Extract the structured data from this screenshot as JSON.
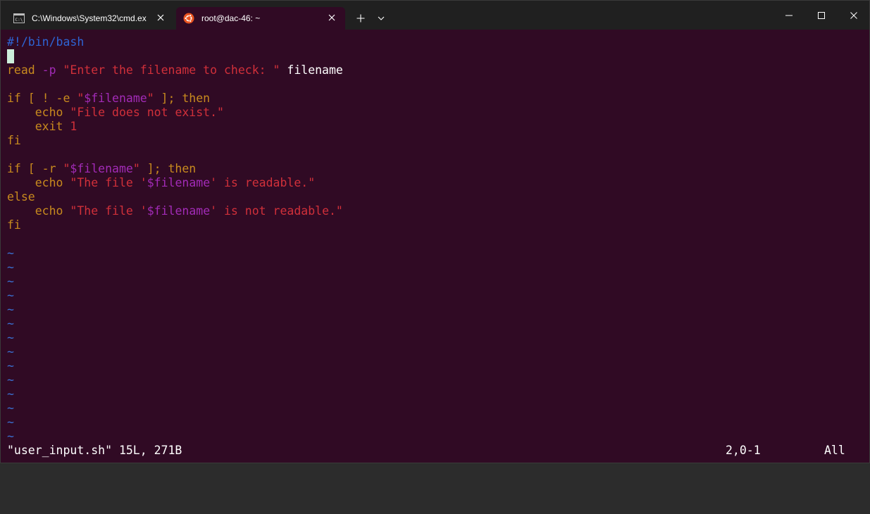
{
  "window": {
    "tabs": [
      {
        "title": "C:\\Windows\\System32\\cmd.ex",
        "icon": "cmd-icon",
        "active": false
      },
      {
        "title": "root@dac-46: ~",
        "icon": "ubuntu-icon",
        "active": true
      }
    ],
    "new_tab_icon": "plus-icon",
    "dropdown_icon": "chevron-down-icon",
    "controls": [
      "minimize-icon",
      "maximize-icon",
      "close-icon"
    ]
  },
  "editor": {
    "lines": {
      "l1": {
        "shebang": "#!/bin/bash"
      },
      "l3": {
        "kw": "read",
        "opt": " -p",
        "str": " \"Enter the filename to check: \"",
        "plain": " filename"
      },
      "l5": {
        "kw1": "if [ ! -e ",
        "q1": "\"",
        "var": "$filename",
        "q2": "\"",
        "kw2": " ]; then"
      },
      "l6": {
        "indent": "    ",
        "kw": "echo",
        "str": " \"File does not exist.\""
      },
      "l7": {
        "indent": "    ",
        "kw": "exit",
        "str": " 1"
      },
      "l8": {
        "kw": "fi"
      },
      "l10": {
        "kw1": "if [ -r ",
        "q1": "\"",
        "var": "$filename",
        "q2": "\"",
        "kw2": " ]; then"
      },
      "l11": {
        "indent": "    ",
        "kw": "echo",
        "str1": " \"The file '",
        "var": "$filename",
        "str2": "' is readable.\""
      },
      "l12": {
        "kw": "else"
      },
      "l13": {
        "indent": "    ",
        "kw": "echo",
        "str1": " \"The file '",
        "var": "$filename",
        "str2": "' is not readable.\""
      },
      "l14": {
        "kw": "fi"
      }
    },
    "tilde": "~",
    "tilde_count": 14
  },
  "status": {
    "file": "\"user_input.sh\" 15L, 271B",
    "position": "2,0-1",
    "scroll": "All"
  },
  "colors": {
    "background": "#300a24",
    "keyword": "#c88a1e",
    "string": "#d1303a",
    "variable": "#a22bb7",
    "shebang": "#2e64d4",
    "tilde": "#3a6fd0",
    "cursor": "#cdeedc"
  }
}
